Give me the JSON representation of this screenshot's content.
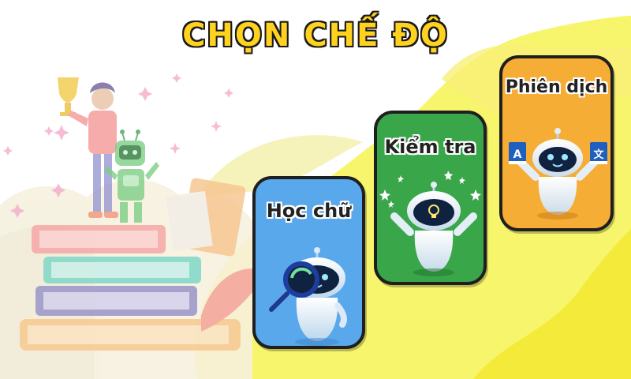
{
  "title": "CHỌN CHẾ ĐỘ",
  "modes": [
    {
      "label": "Học chữ",
      "color": "#5aa8ec"
    },
    {
      "label": "Kiểm tra",
      "color": "#3aa64a"
    },
    {
      "label": "Phiên dịch",
      "color": "#f6ad35"
    }
  ],
  "translate_icons": {
    "left": "A",
    "right": "文"
  },
  "colors": {
    "title_fill": "#ffd21f",
    "outline": "#1f1f1f",
    "blob": "#f5f25a"
  }
}
